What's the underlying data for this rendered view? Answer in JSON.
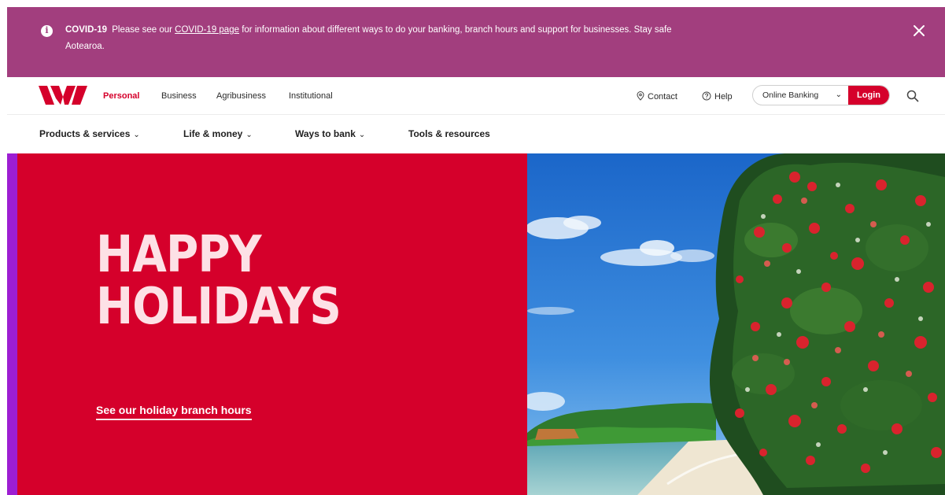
{
  "banner": {
    "label": "COVID-19",
    "text_before": "Please see our",
    "link": "COVID-19 page",
    "text_after": "for information about different ways to do your banking, branch hours and support for businesses. Stay safe Aotearoa."
  },
  "topnav": {
    "segments": [
      "Personal",
      "Business",
      "Agribusiness",
      "Institutional"
    ],
    "active_segment": "Personal",
    "contact": "Contact",
    "help": "Help",
    "online_banking": "Online Banking",
    "login": "Login"
  },
  "subnav": {
    "items": [
      "Products & services",
      "Life & money",
      "Ways to bank",
      "Tools & resources"
    ]
  },
  "hero": {
    "headline_line1": "HAPPY",
    "headline_line2": "HOLIDAYS",
    "link": "See our holiday branch hours"
  },
  "colors": {
    "banner": "#a23e7e",
    "brand_red": "#d5002b",
    "accent_purple": "#9d1ed2",
    "headline_pink": "#fde1e6"
  }
}
